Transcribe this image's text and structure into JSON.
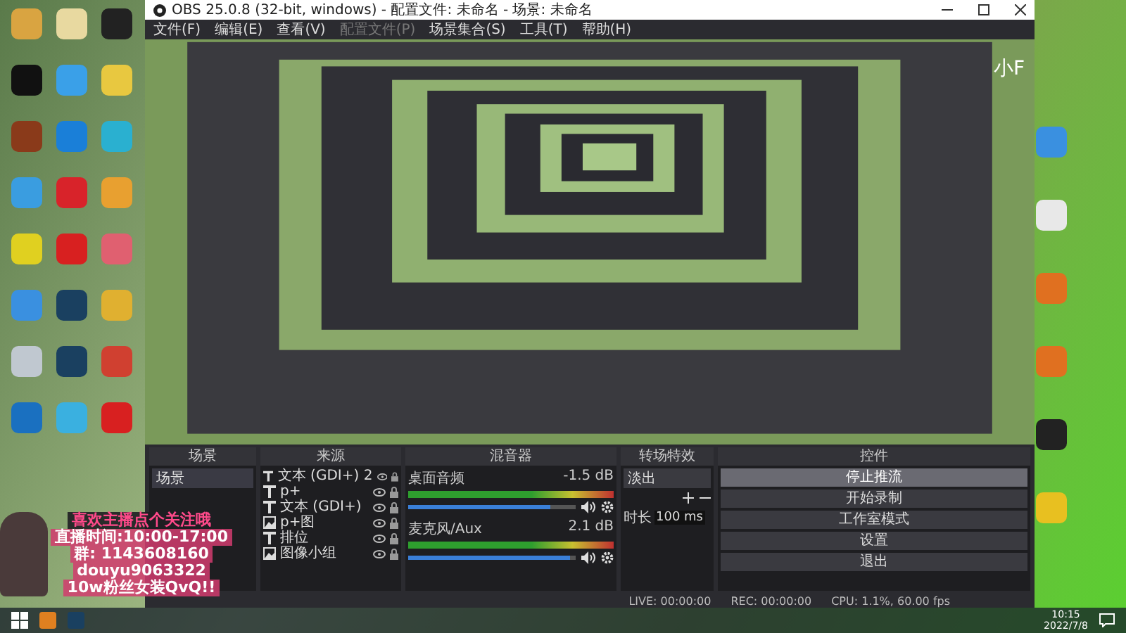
{
  "window": {
    "title": "OBS 25.0.8 (32-bit, windows) - 配置文件: 未命名 - 场景: 未命名"
  },
  "menu": [
    {
      "label": "文件(F)",
      "disabled": false
    },
    {
      "label": "编辑(E)",
      "disabled": false
    },
    {
      "label": "查看(V)",
      "disabled": false
    },
    {
      "label": "配置文件(P)",
      "disabled": true
    },
    {
      "label": "场景集合(S)",
      "disabled": false
    },
    {
      "label": "工具(T)",
      "disabled": false
    },
    {
      "label": "帮助(H)",
      "disabled": false
    }
  ],
  "desktop_text": "小F",
  "overlay": {
    "lines": [
      "喜欢主播点个关注哦",
      "直播时间:10:00-17:00",
      "群: 1143608160",
      "douyu9063322",
      "10w粉丝女装QvQ!!"
    ]
  },
  "scenes": {
    "title": "场景",
    "items": [
      {
        "label": "场景",
        "selected": true
      }
    ]
  },
  "sources": {
    "title": "来源",
    "items": [
      {
        "label": "文本 (GDI+) 2",
        "kind": "text"
      },
      {
        "label": "p+",
        "kind": "text"
      },
      {
        "label": "文本 (GDI+)",
        "kind": "text"
      },
      {
        "label": "p+图",
        "kind": "image"
      },
      {
        "label": "排位",
        "kind": "text"
      },
      {
        "label": "图像小组",
        "kind": "image"
      }
    ]
  },
  "mixer": {
    "title": "混音器",
    "channels": [
      {
        "name": "桌面音频",
        "reading": "-1.5 dB",
        "level": 0.85
      },
      {
        "name": "麦克风/Aux",
        "reading": "2.1 dB",
        "level": 0.97
      }
    ]
  },
  "transitions": {
    "title": "转场特效",
    "type": "淡出",
    "duration_label": "时长",
    "duration": "100 ms"
  },
  "controls": {
    "title": "控件",
    "buttons": [
      {
        "label": "停止推流",
        "selected": true
      },
      {
        "label": "开始录制",
        "selected": false
      },
      {
        "label": "工作室模式",
        "selected": false
      },
      {
        "label": "设置",
        "selected": false
      },
      {
        "label": "退出",
        "selected": false
      }
    ]
  },
  "status_bar": {
    "live": "LIVE: 00:00:00",
    "rec": "REC: 00:00:00",
    "cpu": "CPU: 1.1%, 60.00 fps"
  },
  "taskbar": {
    "time": "10:15",
    "date": "2022/7/8"
  }
}
